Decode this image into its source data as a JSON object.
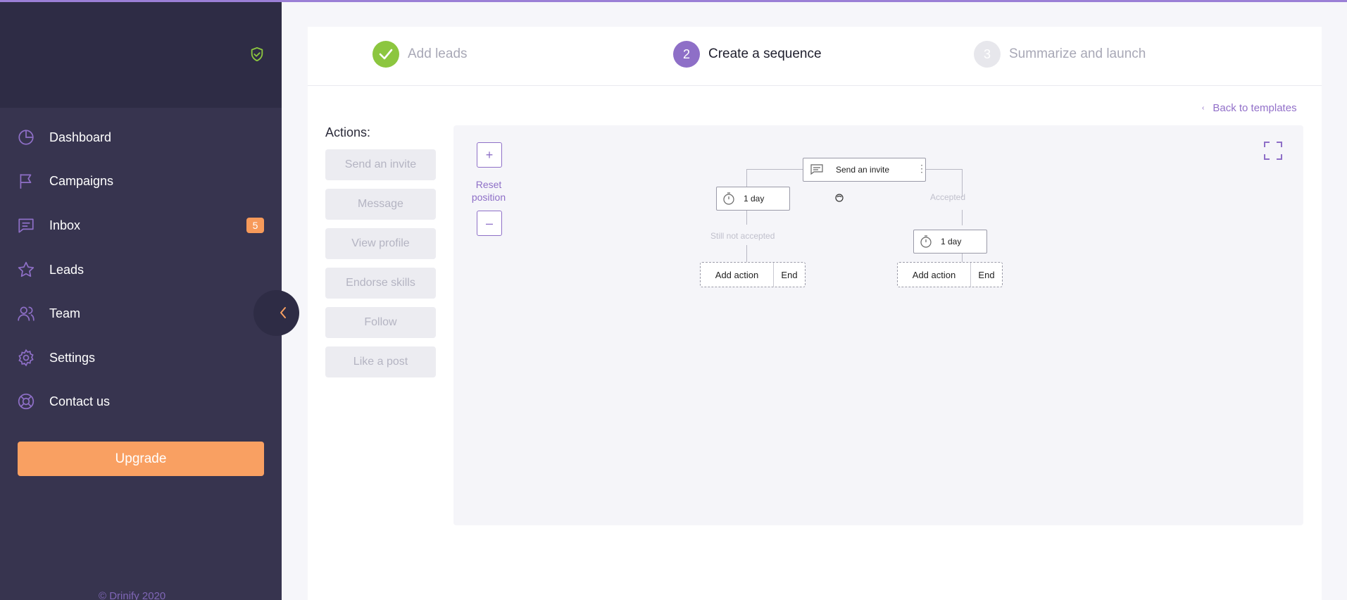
{
  "sidebar": {
    "items": [
      {
        "label": "Dashboard",
        "icon": "pie-chart-icon"
      },
      {
        "label": "Campaigns",
        "icon": "flag-icon"
      },
      {
        "label": "Inbox",
        "icon": "message-icon",
        "badge": "5"
      },
      {
        "label": "Leads",
        "icon": "star-icon"
      },
      {
        "label": "Team",
        "icon": "team-icon"
      },
      {
        "label": "Settings",
        "icon": "gear-icon"
      },
      {
        "label": "Contact us",
        "icon": "lifebuoy-icon"
      }
    ],
    "upgrade_label": "Upgrade",
    "copyright": "© Drinify 2020"
  },
  "steps": [
    {
      "number": "",
      "label": "Add leads",
      "state": "done"
    },
    {
      "number": "2",
      "label": "Create a sequence",
      "state": "active"
    },
    {
      "number": "3",
      "label": "Summarize and launch",
      "state": "pending"
    }
  ],
  "back_link": "Back to templates",
  "actions": {
    "title": "Actions:",
    "items": [
      "Send an invite",
      "Message",
      "View profile",
      "Endorse skills",
      "Follow",
      "Like a post"
    ]
  },
  "canvas": {
    "zoom_in": "+",
    "zoom_out": "–",
    "reset_label": "Reset position",
    "root_node": "Send an invite",
    "left_delay": "1 day",
    "left_branch": "Still not accepted",
    "right_branch": "Accepted",
    "right_delay": "1 day",
    "add_action": "Add action",
    "end": "End"
  },
  "colors": {
    "accent": "#8e6fc7",
    "sidebar": "#37344f",
    "sidebar_top": "#2e2c45",
    "upgrade": "#f9a062",
    "success": "#8cc63f",
    "badge": "#f79a5a"
  }
}
